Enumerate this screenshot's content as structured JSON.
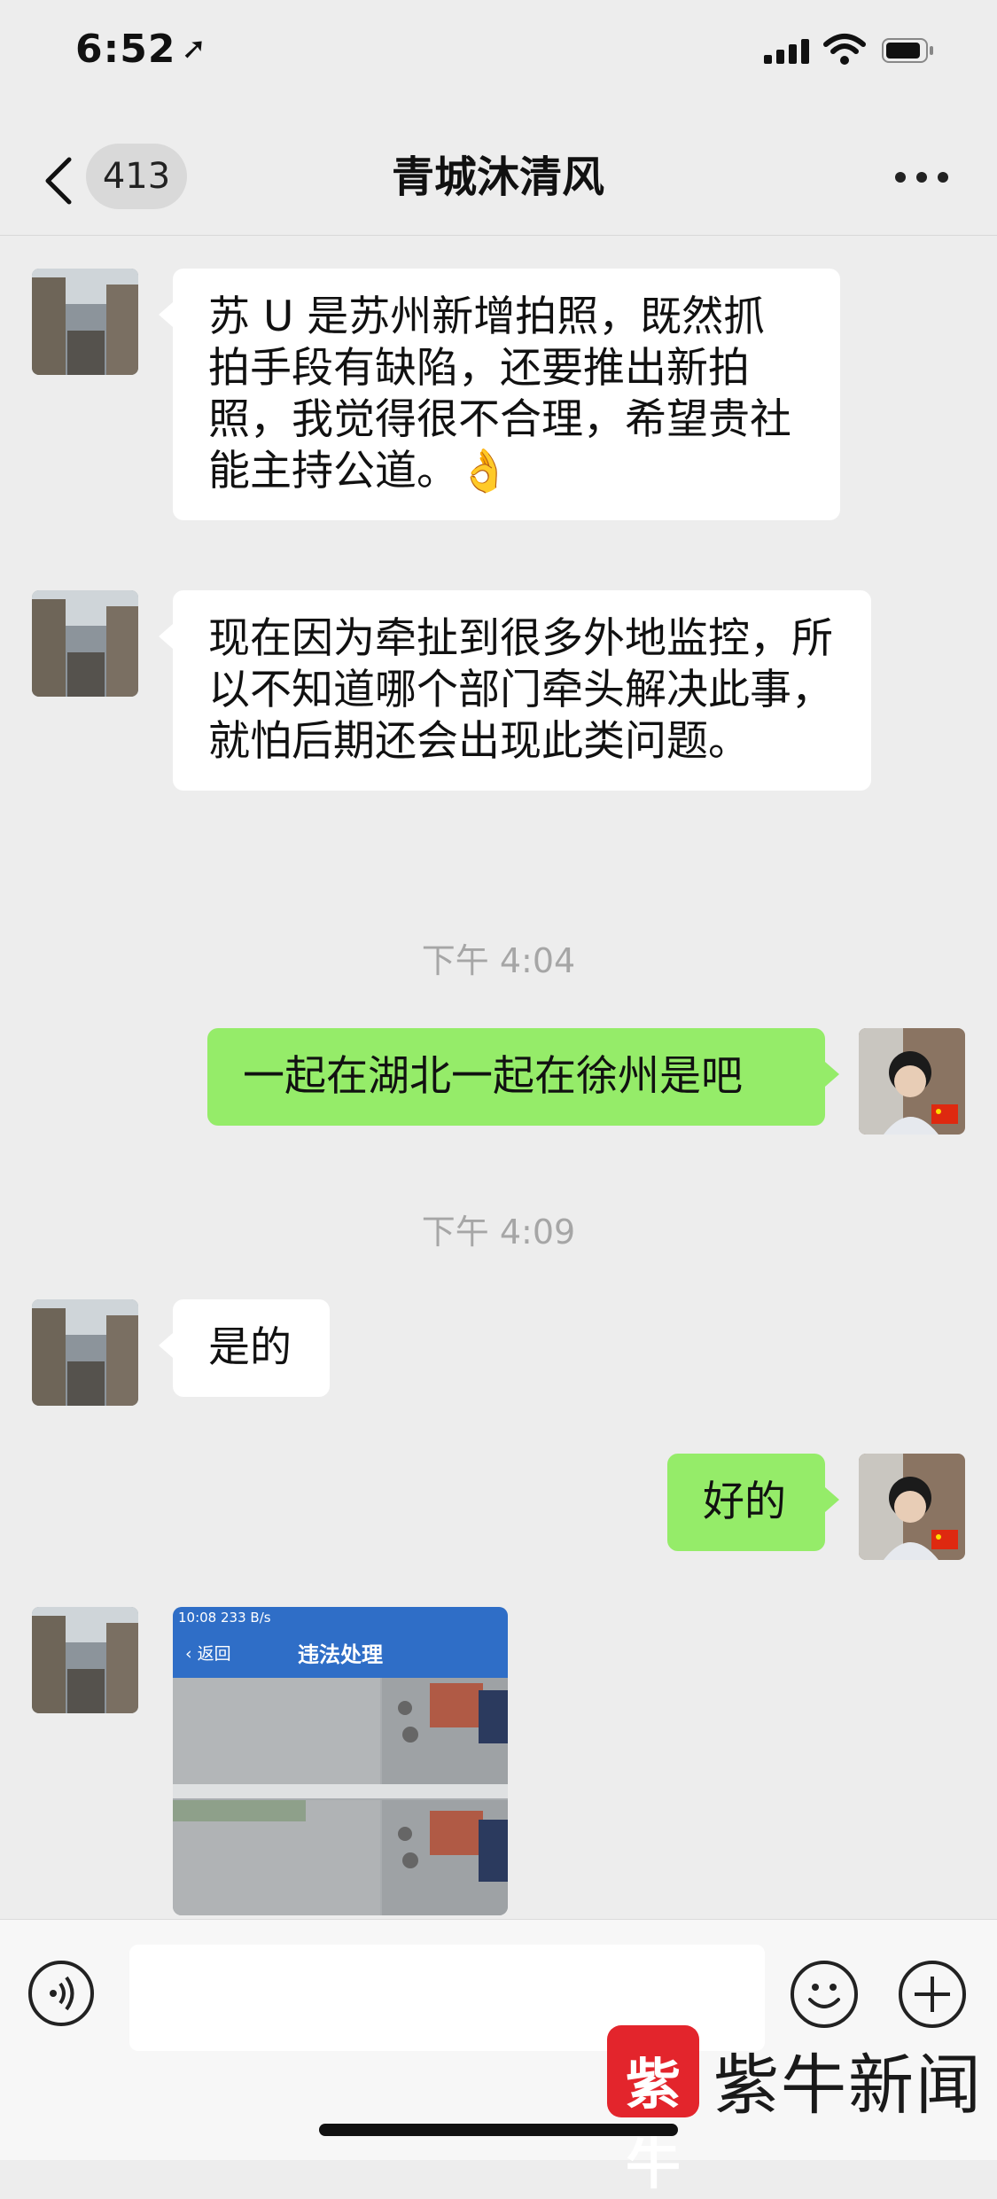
{
  "status_bar": {
    "time": "6:52"
  },
  "nav": {
    "unread_count": "413",
    "title": "青城沐清风"
  },
  "messages": [
    {
      "side": "incoming",
      "text": "苏 U 是苏州新增拍照，既然抓拍手段有缺陷，还要推出新拍照，我觉得很不合理，希望贵社能主持公道。👌"
    },
    {
      "side": "incoming",
      "text": "现在因为牵扯到很多外地监控，所以不知道哪个部门牵头解决此事，就怕后期还会出现此类问题。"
    },
    {
      "type": "timestamp",
      "text": "下午 4:04"
    },
    {
      "side": "outgoing",
      "text": "一起在湖北一起在徐州是吧"
    },
    {
      "type": "timestamp",
      "text": "下午 4:09"
    },
    {
      "side": "incoming",
      "text": "是的"
    },
    {
      "side": "outgoing",
      "text": "好的"
    },
    {
      "side": "incoming",
      "type": "image",
      "image": {
        "status_time": "10:08",
        "status_speed": "233 B/s",
        "back_label": "返回",
        "title": "违法处理"
      }
    }
  ],
  "watermark": {
    "logo_char": "紫牛",
    "text": "紫牛新闻"
  },
  "colors": {
    "background": "#ededed",
    "outgoing_bubble": "#95ec69",
    "incoming_bubble": "#ffffff",
    "image_header": "#2f6ec7"
  },
  "icons": [
    "back-icon",
    "more-icon",
    "voice-icon",
    "emoji-icon",
    "plus-icon",
    "flag-icon"
  ]
}
